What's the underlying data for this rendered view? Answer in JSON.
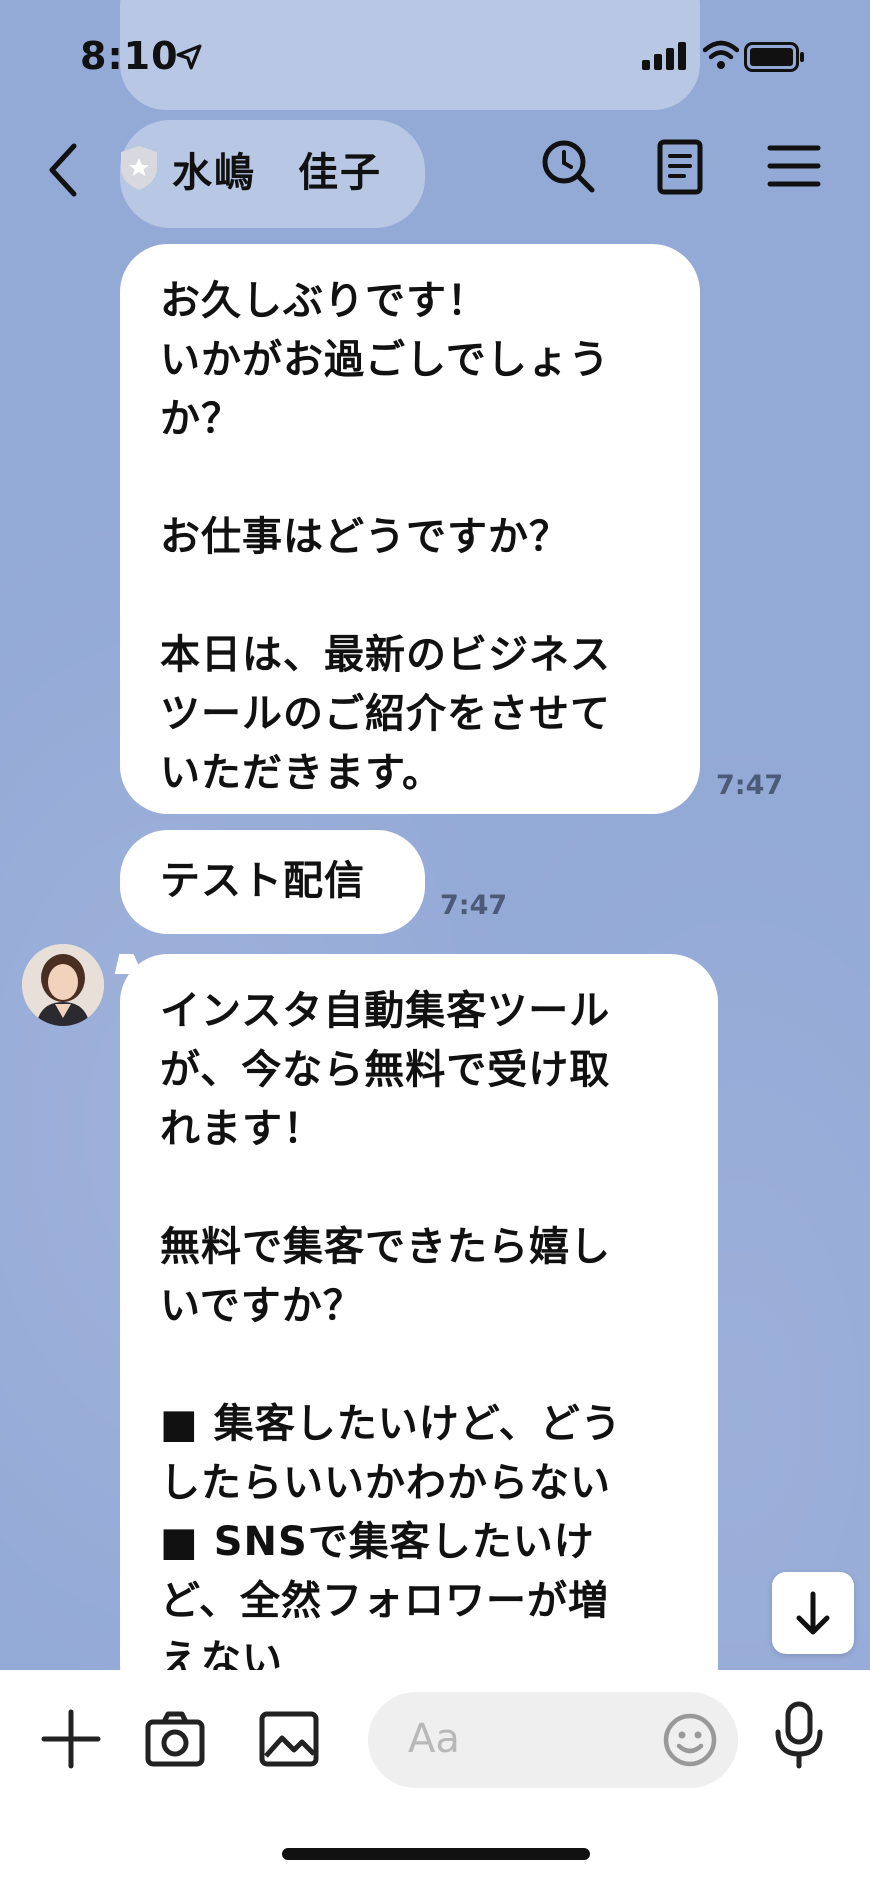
{
  "status_bar": {
    "time": "8:10"
  },
  "header": {
    "contact_name": "水嶋　佳子"
  },
  "messages": [
    {
      "text": "お久しぶりです！\nいかがお過ごしでしょう\nか？\n\nお仕事はどうですか？\n\n本日は、最新のビジネス\nツールのご紹介をさせて\nいただきます。",
      "time": "7:47"
    },
    {
      "text": "テスト配信",
      "time": "7:47"
    },
    {
      "text": "インスタ自動集客ツール\nが、今なら無料で受け取\nれます！\n\n無料で集客できたら嬉し\nいですか？\n\n■ 集客したいけど、どう\nしたらいいかわからない\n■ SNSで集客したいけ\nど、全然フォロワーが増\nえない"
    }
  ],
  "input": {
    "placeholder": "Aa"
  },
  "icons": [
    "back-icon",
    "shield-icon",
    "search-icon",
    "notes-icon",
    "menu-icon",
    "plus-icon",
    "camera-icon",
    "image-icon",
    "emoji-icon",
    "mic-icon",
    "arrow-down-icon"
  ]
}
